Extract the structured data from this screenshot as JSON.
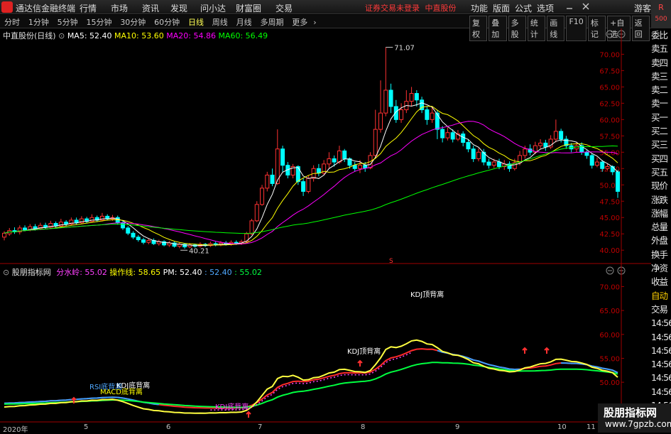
{
  "titlebar": {
    "app_title": "通达信金融终端",
    "menu": [
      "行情",
      "市场",
      "资讯",
      "发现",
      "问小达",
      "财富圈",
      "交易"
    ],
    "status_text": "证券交易未登录",
    "stock_name": "中直股份",
    "right_menu": [
      "功能",
      "版面",
      "公式",
      "选项"
    ],
    "guest": "游客",
    "r_badge_top": "R",
    "r_badge_bottom": "500"
  },
  "toolbar": {
    "periods": [
      "分时",
      "1分钟",
      "5分钟",
      "15分钟",
      "30分钟",
      "60分钟",
      "日线",
      "周线",
      "月线",
      "多周期",
      "更多"
    ],
    "active_period": "日线",
    "tools": [
      "复权",
      "叠加",
      "多股",
      "统计",
      "画线",
      "F10",
      "标记",
      "+自选",
      "返回"
    ]
  },
  "main_chart": {
    "title": "中直股份(日线)",
    "ma": [
      {
        "label": "MA5: 52.40",
        "color": "#ffffff"
      },
      {
        "label": "MA10: 53.60",
        "color": "#ffff00"
      },
      {
        "label": "MA20: 54.86",
        "color": "#ff00ff"
      },
      {
        "label": "MA60: 56.49",
        "color": "#00ff00"
      }
    ],
    "y_ticks": [
      "70.00",
      "67.50",
      "65.00",
      "62.50",
      "60.00",
      "57.50",
      "55.00",
      "52.50",
      "50.00",
      "47.50",
      "45.00",
      "42.50",
      "40.00"
    ],
    "high_label": "71.07",
    "low_label": "40.21",
    "marker_s": "S"
  },
  "indicator": {
    "title": "股朋指标网",
    "fields": [
      {
        "label": "分水岭: 55.02",
        "color": "#ff40ff"
      },
      {
        "label": "操作线: 58.65",
        "color": "#ffff00"
      },
      {
        "label": "PM: 52.40",
        "color": "#ffffff"
      },
      {
        "label": ": 52.40",
        "color": "#4fa8ff"
      },
      {
        "label": ": 55.02",
        "color": "#00ff40"
      }
    ],
    "y_ticks": [
      "70.00",
      "65.00",
      "60.00",
      "55.00",
      "50.00",
      "45.00"
    ],
    "annotations": [
      {
        "text": "KDJ顶背离",
        "color": "#ffffff"
      },
      {
        "text": "KDJ顶背离",
        "color": "#ffffff"
      },
      {
        "text": "RSI底背离",
        "color": "#4fa8ff"
      },
      {
        "text": "KDJ底背离",
        "color": "#ffffff"
      },
      {
        "text": "MACD底背离",
        "color": "#ffff00"
      },
      {
        "text": "KDJ底背离",
        "color": "#ff40ff"
      }
    ]
  },
  "time_axis": [
    "2020年",
    "5",
    "6",
    "7",
    "8",
    "9",
    "10",
    "11"
  ],
  "sidebar": [
    {
      "label": "委比",
      "color": "white"
    },
    {
      "label": "卖五",
      "color": "white"
    },
    {
      "label": "卖四",
      "color": "white"
    },
    {
      "label": "卖三",
      "color": "white"
    },
    {
      "label": "卖二",
      "color": "white"
    },
    {
      "label": "卖一",
      "color": "white"
    },
    {
      "label": "买一",
      "color": "white"
    },
    {
      "label": "买二",
      "color": "white"
    },
    {
      "label": "买三",
      "color": "white"
    },
    {
      "label": "买四",
      "color": "white"
    },
    {
      "label": "买五",
      "color": "white"
    },
    {
      "label": "现价",
      "color": "white"
    },
    {
      "label": "涨跌",
      "color": "white"
    },
    {
      "label": "涨幅",
      "color": "white"
    },
    {
      "label": "总量",
      "color": "white"
    },
    {
      "label": "外盘",
      "color": "white"
    },
    {
      "label": "换手",
      "color": "white"
    },
    {
      "label": "净资",
      "color": "white"
    },
    {
      "label": "收益",
      "color": "white"
    },
    {
      "label": "自动",
      "color": "yellow"
    },
    {
      "label": "交易",
      "color": "white"
    },
    {
      "label": "14:56",
      "color": "white"
    },
    {
      "label": "14:56",
      "color": "white"
    },
    {
      "label": "14:56",
      "color": "white"
    },
    {
      "label": "14:56",
      "color": "white"
    },
    {
      "label": "14:56",
      "color": "white"
    },
    {
      "label": "14:56",
      "color": "white"
    },
    {
      "label": "14:56",
      "color": "white"
    },
    {
      "label": "14:56",
      "color": "white"
    }
  ],
  "watermark": {
    "line1": "股朋指标网",
    "line2": "www.7gpzb.com"
  },
  "chart_data": {
    "type": "candlestick",
    "title": "中直股份(日线)",
    "ylim": [
      38.5,
      72
    ],
    "candles": [
      [
        42.0,
        42.6,
        41.5,
        42.9
      ],
      [
        42.5,
        43.0,
        42.2,
        43.4
      ],
      [
        43.0,
        42.8,
        42.5,
        43.5
      ],
      [
        42.8,
        43.4,
        42.4,
        43.8
      ],
      [
        43.4,
        43.1,
        42.9,
        43.8
      ],
      [
        43.1,
        43.6,
        42.9,
        44.0
      ],
      [
        43.6,
        43.3,
        43.0,
        44.0
      ],
      [
        43.3,
        43.8,
        43.1,
        44.2
      ],
      [
        43.8,
        43.5,
        43.2,
        44.2
      ],
      [
        43.5,
        44.1,
        43.3,
        44.5
      ],
      [
        44.1,
        43.7,
        43.4,
        44.4
      ],
      [
        43.7,
        44.3,
        43.6,
        44.8
      ],
      [
        44.3,
        44.0,
        43.7,
        44.6
      ],
      [
        44.0,
        44.6,
        43.8,
        45.0
      ],
      [
        44.6,
        44.2,
        43.9,
        45.0
      ],
      [
        44.2,
        44.8,
        44.0,
        45.2
      ],
      [
        44.8,
        44.4,
        44.1,
        45.1
      ],
      [
        44.4,
        45.0,
        44.2,
        45.5
      ],
      [
        45.0,
        44.6,
        44.3,
        45.3
      ],
      [
        44.6,
        45.2,
        44.4,
        45.7
      ],
      [
        45.2,
        44.8,
        44.6,
        45.5
      ],
      [
        44.8,
        45.0,
        44.5,
        45.4
      ],
      [
        45.0,
        44.2,
        43.9,
        45.3
      ],
      [
        44.2,
        43.4,
        43.1,
        44.5
      ],
      [
        43.4,
        42.6,
        42.3,
        43.7
      ],
      [
        42.6,
        42.0,
        41.7,
        42.9
      ],
      [
        42.0,
        41.6,
        41.3,
        42.3
      ],
      [
        41.6,
        41.2,
        40.9,
        41.9
      ],
      [
        41.2,
        41.5,
        40.9,
        41.8
      ],
      [
        41.5,
        41.0,
        40.8,
        41.8
      ],
      [
        41.0,
        41.3,
        40.7,
        41.6
      ],
      [
        41.3,
        40.8,
        40.6,
        41.5
      ],
      [
        40.8,
        41.1,
        40.5,
        41.4
      ],
      [
        41.1,
        40.6,
        40.4,
        41.3
      ],
      [
        40.6,
        40.9,
        40.3,
        41.2
      ],
      [
        40.9,
        40.5,
        40.21,
        41.1
      ],
      [
        40.5,
        40.8,
        40.3,
        41.1
      ],
      [
        40.8,
        40.6,
        40.4,
        41.0
      ],
      [
        40.6,
        40.9,
        40.4,
        41.2
      ],
      [
        40.9,
        40.7,
        40.5,
        41.1
      ],
      [
        40.7,
        41.0,
        40.5,
        41.3
      ],
      [
        41.0,
        40.8,
        40.6,
        41.3
      ],
      [
        40.8,
        41.1,
        40.6,
        41.4
      ],
      [
        41.1,
        40.9,
        40.7,
        41.4
      ],
      [
        40.9,
        41.2,
        40.7,
        41.5
      ],
      [
        41.2,
        41.0,
        40.8,
        41.5
      ],
      [
        41.0,
        41.3,
        40.8,
        41.6
      ],
      [
        41.3,
        42.5,
        41.1,
        42.8
      ],
      [
        42.5,
        44.5,
        42.3,
        44.8
      ],
      [
        44.5,
        47.0,
        44.3,
        47.5
      ],
      [
        47.0,
        49.5,
        46.8,
        50.0
      ],
      [
        49.5,
        51.5,
        49.0,
        52.0
      ],
      [
        51.5,
        50.2,
        49.8,
        52.5
      ],
      [
        50.2,
        55.5,
        50.0,
        58.5
      ],
      [
        55.5,
        53.0,
        52.0,
        56.0
      ],
      [
        53.0,
        51.5,
        51.0,
        53.5
      ],
      [
        51.5,
        52.8,
        51.0,
        53.2
      ],
      [
        52.8,
        50.5,
        50.0,
        53.0
      ],
      [
        50.5,
        49.0,
        48.3,
        51.0
      ],
      [
        49.0,
        51.0,
        48.7,
        51.5
      ],
      [
        51.0,
        52.5,
        50.5,
        53.0
      ],
      [
        52.5,
        51.8,
        51.3,
        53.2
      ],
      [
        51.8,
        53.2,
        51.5,
        53.8
      ],
      [
        53.2,
        54.0,
        52.5,
        55.0
      ],
      [
        54.0,
        53.5,
        52.8,
        54.5
      ],
      [
        53.5,
        55.2,
        53.2,
        56.0
      ],
      [
        55.2,
        54.0,
        53.5,
        55.5
      ],
      [
        54.0,
        53.0,
        52.5,
        54.2
      ],
      [
        53.0,
        52.5,
        52.0,
        53.5
      ],
      [
        52.5,
        53.0,
        51.8,
        53.8
      ],
      [
        53.0,
        52.6,
        52.0,
        53.5
      ],
      [
        52.6,
        54.5,
        52.4,
        55.0
      ],
      [
        54.5,
        58.5,
        54.0,
        61.5
      ],
      [
        58.5,
        61.0,
        58.0,
        66.0
      ],
      [
        61.0,
        64.5,
        60.5,
        71.07
      ],
      [
        64.5,
        62.0,
        61.0,
        65.5
      ],
      [
        62.0,
        60.0,
        59.5,
        63.0
      ],
      [
        60.0,
        61.5,
        59.5,
        62.5
      ],
      [
        61.5,
        62.8,
        61.0,
        64.5
      ],
      [
        62.8,
        64.0,
        62.0,
        65.0
      ],
      [
        64.0,
        63.0,
        62.0,
        64.5
      ],
      [
        63.0,
        61.5,
        61.0,
        63.5
      ],
      [
        61.5,
        60.0,
        59.2,
        62.0
      ],
      [
        60.0,
        61.0,
        59.5,
        62.0
      ],
      [
        61.0,
        58.5,
        57.0,
        61.5
      ],
      [
        58.5,
        57.2,
        56.5,
        59.0
      ],
      [
        57.2,
        58.0,
        56.8,
        58.8
      ],
      [
        58.0,
        57.0,
        56.5,
        58.5
      ],
      [
        57.0,
        57.8,
        56.7,
        58.4
      ],
      [
        57.8,
        56.5,
        55.9,
        58.2
      ],
      [
        56.5,
        55.5,
        55.0,
        57.0
      ],
      [
        55.5,
        54.0,
        53.5,
        56.0
      ],
      [
        54.0,
        55.0,
        53.6,
        55.6
      ],
      [
        55.0,
        53.5,
        53.0,
        55.5
      ],
      [
        53.5,
        53.0,
        52.5,
        54.0
      ],
      [
        53.0,
        53.5,
        52.6,
        54.0
      ],
      [
        53.5,
        52.8,
        52.4,
        54.0
      ],
      [
        52.8,
        53.2,
        52.3,
        53.8
      ],
      [
        53.2,
        52.5,
        52.0,
        53.6
      ],
      [
        52.5,
        53.4,
        52.2,
        54.0
      ],
      [
        53.4,
        54.5,
        53.0,
        55.2
      ],
      [
        54.5,
        55.5,
        54.0,
        56.0
      ],
      [
        55.5,
        55.0,
        54.5,
        56.2
      ],
      [
        55.0,
        56.0,
        54.7,
        56.6
      ],
      [
        56.0,
        56.4,
        55.5,
        57.0
      ],
      [
        56.4,
        55.8,
        55.2,
        56.9
      ],
      [
        55.8,
        57.0,
        55.5,
        57.6
      ],
      [
        57.0,
        58.2,
        56.5,
        60.0
      ],
      [
        58.2,
        57.0,
        56.5,
        58.6
      ],
      [
        57.0,
        56.0,
        55.5,
        57.5
      ],
      [
        56.0,
        55.5,
        55.0,
        56.4
      ],
      [
        55.5,
        56.0,
        55.0,
        56.6
      ],
      [
        56.0,
        55.0,
        54.6,
        56.5
      ],
      [
        55.0,
        54.5,
        54.0,
        55.3
      ],
      [
        54.5,
        53.0,
        52.5,
        54.8
      ],
      [
        53.0,
        53.5,
        52.7,
        54.2
      ],
      [
        53.5,
        52.5,
        52.0,
        53.8
      ],
      [
        52.5,
        52.8,
        52.2,
        53.2
      ],
      [
        52.8,
        52.0,
        51.5,
        53.0
      ],
      [
        52.0,
        49.0,
        48.0,
        52.3
      ]
    ]
  }
}
